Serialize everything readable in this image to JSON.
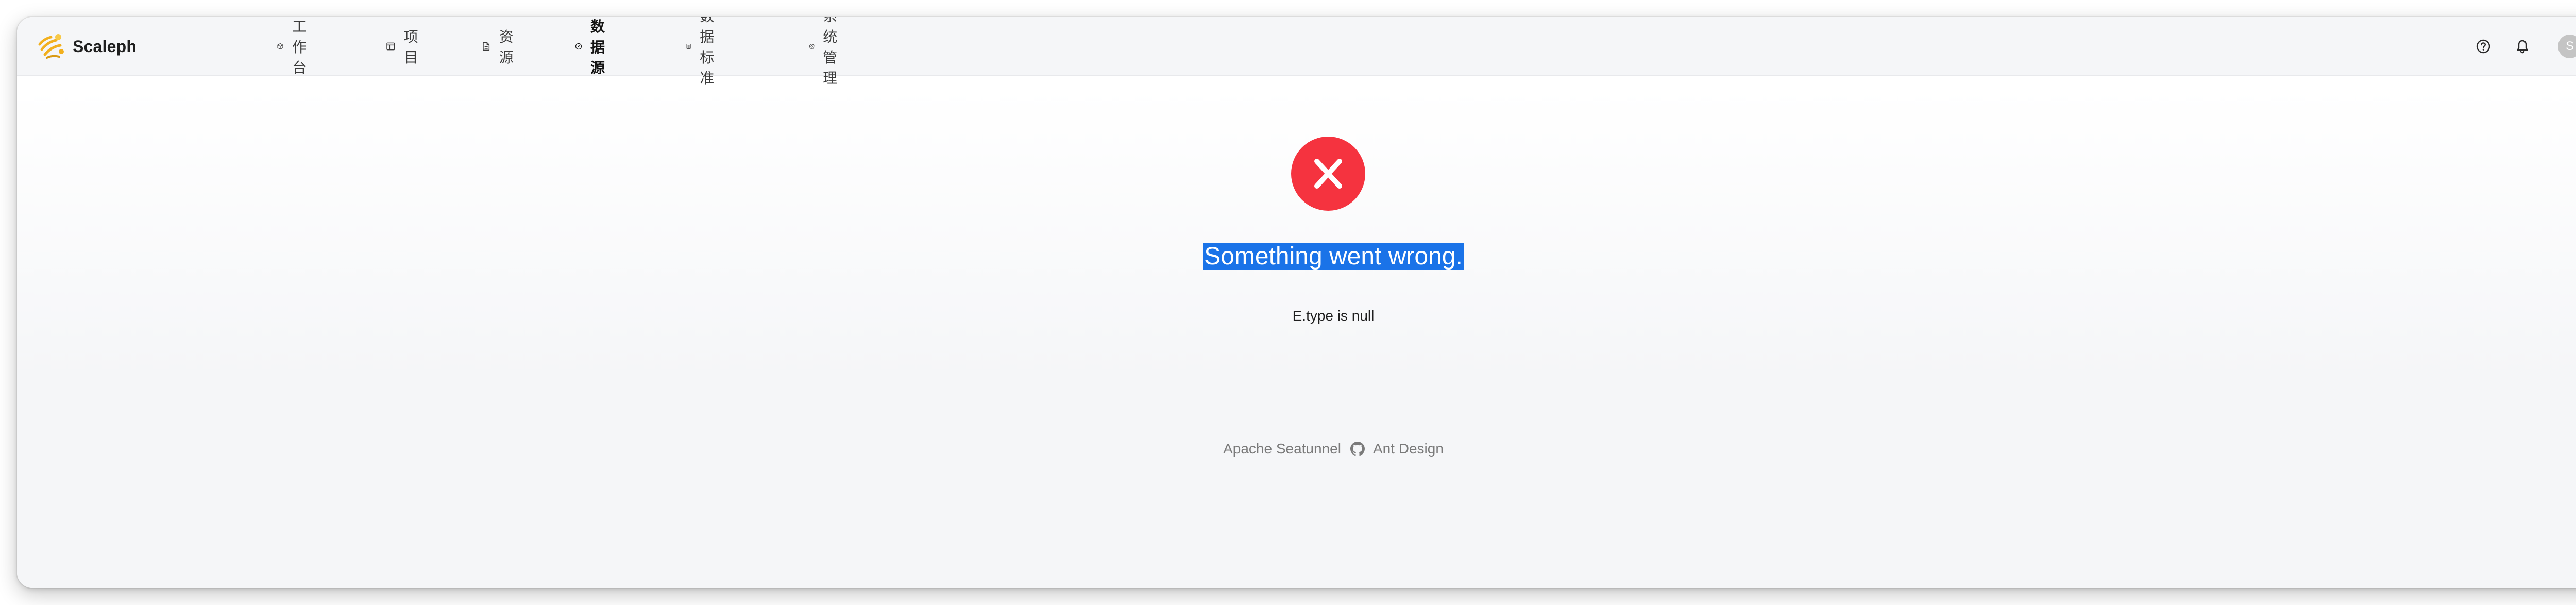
{
  "app": {
    "name": "Scaleph",
    "logo_icon": "scaleph-bee-logo"
  },
  "nav": {
    "items": [
      {
        "label": "工作台",
        "icon": "cube-icon",
        "active": false
      },
      {
        "label": "项目",
        "icon": "project-icon",
        "active": false
      },
      {
        "label": "资源",
        "icon": "file-icon",
        "active": false
      },
      {
        "label": "数据源",
        "icon": "compass-icon",
        "active": true
      },
      {
        "label": "数据标准",
        "icon": "book-icon",
        "active": false
      },
      {
        "label": "系统管理",
        "icon": "gear-icon",
        "active": false
      }
    ]
  },
  "header_tools": {
    "help_icon": "question-circle-icon",
    "notification_icon": "bell-icon",
    "avatar_initial": "S",
    "language_icon": "translate-icon"
  },
  "error": {
    "icon": "close-circle-icon",
    "title": "Something went wrong.",
    "detail": "E.type is null"
  },
  "footer": {
    "link1": "Apache Seatunnel",
    "github_icon": "github-icon",
    "link2": "Ant Design"
  },
  "colors": {
    "error_red": "#f5333f",
    "selection_blue": "#1a73e8",
    "brand_yellow": "#f2b01e",
    "header_bg": "#f5f6f8"
  }
}
